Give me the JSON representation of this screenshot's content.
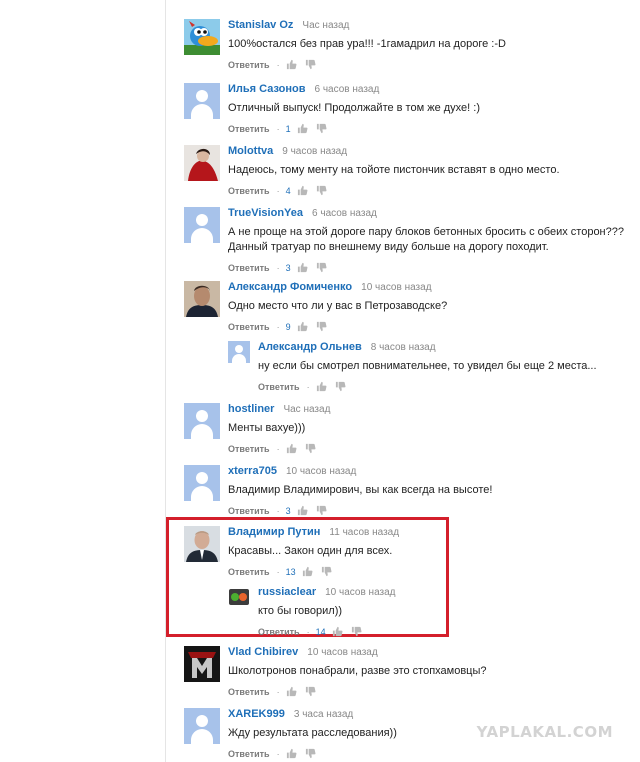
{
  "comments": [
    {
      "author": "Stanislav Oz",
      "time": "Час назад",
      "text": "100%остался без прав ура!!! -1гамадрил на дороге :-D",
      "reply_label": "Ответить",
      "count": "",
      "avatar": "cartoon-bird"
    },
    {
      "author": "Илья Сазонов",
      "time": "6 часов назад",
      "text": "Отличный выпуск! Продолжайте в том же духе! :)",
      "reply_label": "Ответить",
      "count": "1",
      "avatar": "default"
    },
    {
      "author": "Molottva",
      "time": "9 часов назад",
      "text": "Надеюсь, тому менту на тойоте пистончик вставят в одно место.",
      "reply_label": "Ответить",
      "count": "4",
      "avatar": "photo-red"
    },
    {
      "author": "TrueVisionYea",
      "time": "6 часов назад",
      "text": "А не проще на этой дороге пару блоков бетонных бросить с обеих сторон??? Данный тратуар по внешнему виду больше на дорогу походит.",
      "reply_label": "Ответить",
      "count": "3",
      "avatar": "default"
    },
    {
      "author": "Александр Фомиченко",
      "time": "10 часов назад",
      "text": "Одно место что ли у вас в Петрозаводске?",
      "reply_label": "Ответить",
      "count": "9",
      "avatar": "photo-man"
    },
    {
      "author": "Александр Ольнев",
      "time": "8 часов назад",
      "text": "ну если бы смотрел повнимательнее, то увидел бы еще 2 места...",
      "reply_label": "Ответить",
      "count": "",
      "avatar": "default",
      "reply": true
    },
    {
      "author": "hostliner",
      "time": "Час назад",
      "text": "Менты вахуе)))",
      "reply_label": "Ответить",
      "count": "",
      "avatar": "default"
    },
    {
      "author": "xterra705",
      "time": "10 часов назад",
      "text": "Владимир Владимирович, вы как всегда на высоте!",
      "reply_label": "Ответить",
      "count": "3",
      "avatar": "default"
    },
    {
      "author": "Владимир Путин",
      "time": "11 часов назад",
      "text": "Красавы... Закон один для всех.",
      "reply_label": "Ответить",
      "count": "13",
      "avatar": "photo-suit"
    },
    {
      "author": "russiaclear",
      "time": "10 часов назад",
      "text": "кто бы говорил))",
      "reply_label": "Ответить",
      "count": "14",
      "avatar": "cartoon-green",
      "reply": true
    },
    {
      "author": "Vlad Chibirev",
      "time": "10 часов назад",
      "text": "Школотронов понабрали, разве это стопхамовцы?",
      "reply_label": "Ответить",
      "count": "",
      "avatar": "logo-m"
    },
    {
      "author": "XAREK999",
      "time": "3 часа назад",
      "text": "Жду результата расследования))",
      "reply_label": "Ответить",
      "count": "",
      "avatar": "default"
    }
  ],
  "watermark": "YAPLAKAL.COM",
  "colors": {
    "author": "#1f6fb8",
    "highlight_border": "#d41f2b",
    "avatar_default": "#a7c2ea"
  }
}
